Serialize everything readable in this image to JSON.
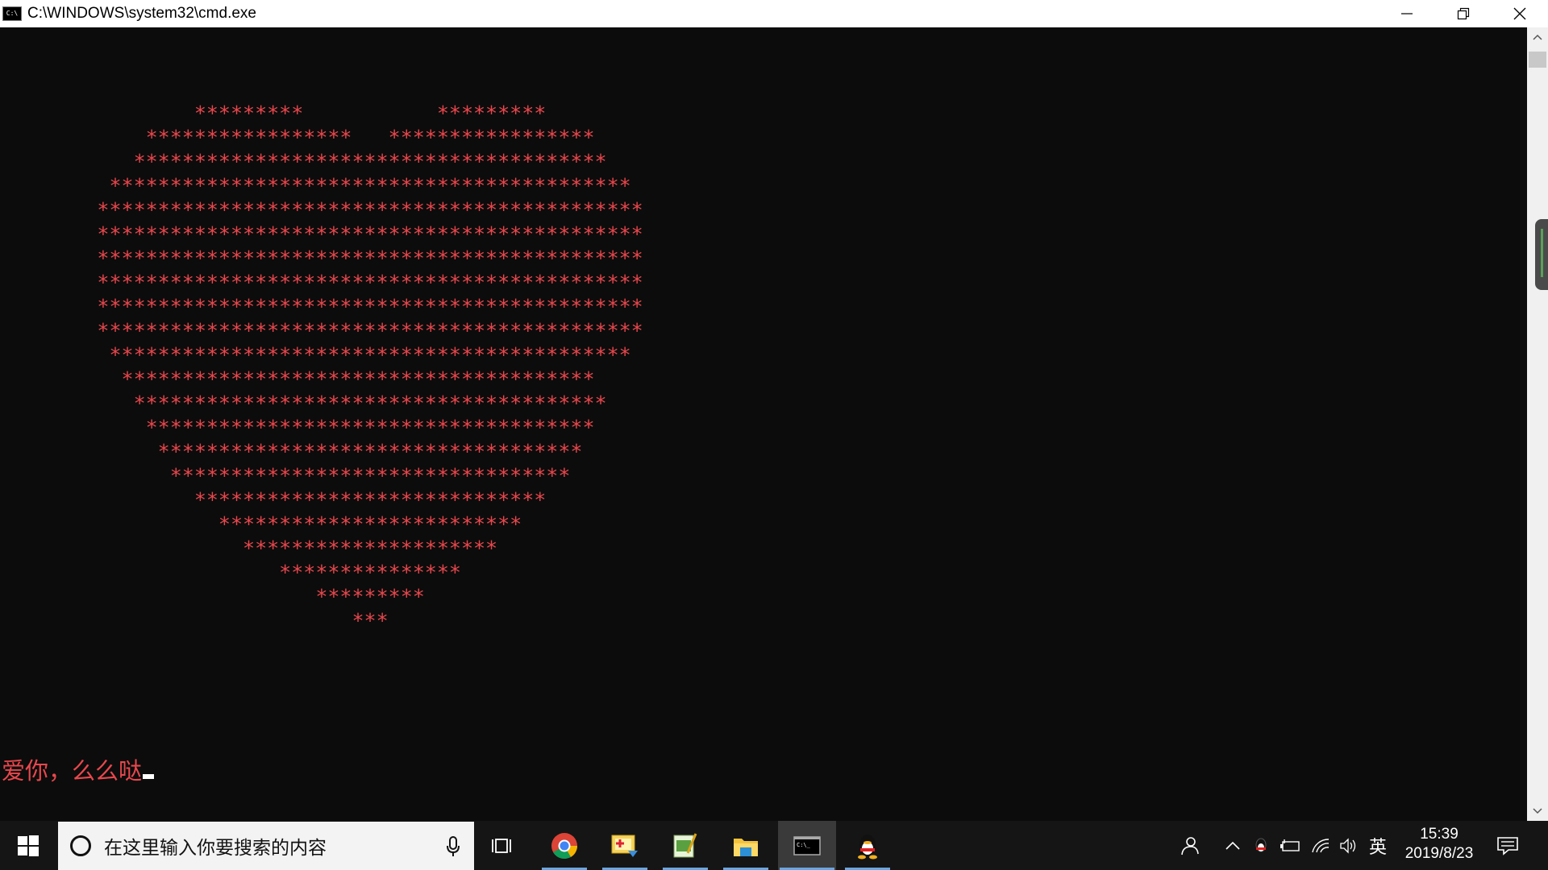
{
  "window": {
    "title": "C:\\WINDOWS\\system32\\cmd.exe",
    "icon_glyph": "C:\\",
    "icon": "cmd-icon",
    "controls": [
      "minimize-icon",
      "restore-icon",
      "close-icon"
    ]
  },
  "console": {
    "heart_lines": [
      "                *********           *********",
      "            *****************   *****************",
      "           ***************************************",
      "         *******************************************",
      "        *********************************************",
      "        *********************************************",
      "        *********************************************",
      "        *********************************************",
      "        *********************************************",
      "        *********************************************",
      "         *******************************************",
      "          ***************************************",
      "           ***************************************",
      "            *************************************",
      "             ***********************************",
      "              *********************************",
      "                *****************************",
      "                  *************************",
      "                    *********************",
      "                       ***************",
      "                          *********",
      "                             ***"
    ],
    "text_color": "#e8474d",
    "background": "#0c0c0c",
    "message": "爱你，么么哒"
  },
  "taskbar": {
    "search_placeholder": "在这里输入你要搜索的内容",
    "apps": [
      "chrome-icon",
      "photo-editor-icon",
      "notepad-plus-icon",
      "file-explorer-icon",
      "cmd-icon",
      "qq-icon"
    ],
    "active_app": "cmd-icon",
    "tray_icons": [
      "people-icon",
      "chevron-up-icon",
      "qq-tray-icon",
      "battery-icon",
      "wifi-icon",
      "volume-icon"
    ],
    "input_language": "英",
    "time": "15:39",
    "date": "2019/8/23",
    "notification_icon": "notification-icon",
    "underline_color": "#6aa6e0"
  }
}
